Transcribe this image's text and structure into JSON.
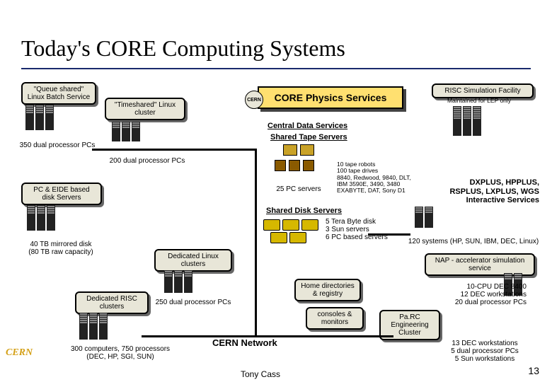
{
  "title": "Today's CORE Computing Systems",
  "headline": {
    "label": "CORE Physics Services",
    "tag": "CERN"
  },
  "left": {
    "queueShared": "\"Queue shared\" Linux Batch Service",
    "queueSharedNote": "350 dual processor PCs",
    "pcEide": "PC & EIDE based disk Servers",
    "mirrored": "40 TB mirrored disk\n(80 TB raw capacity)",
    "dedicatedRisc": "Dedicated RISC clusters",
    "riscNote": "300 computers, 750 processors\n(DEC, HP, SGI, SUN)"
  },
  "mid": {
    "timeshared": "\"Timeshared\" Linux cluster",
    "timesharedNote": "200 dual processor PCs",
    "dedicatedLinux": "Dedicated Linux clusters",
    "dedicatedLinuxNote": "250 dual processor PCs"
  },
  "center": {
    "centralData": "Central Data Services",
    "sharedTape": "Shared Tape Servers",
    "tapeServers": "25 PC servers",
    "tapeDetails": "10 tape robots\n100 tape drives\n8840, Redwood, 9840, DLT,\nIBM 3590E, 3490, 3480\nEXABYTE, DAT, Sony D1",
    "sharedDisk": "Shared Disk Servers",
    "diskDetails": "5 Tera Byte disk\n3 Sun servers\n6 PC based servers",
    "home": "Home directories & registry",
    "consoles": "consoles & monitors",
    "cernNetwork": "CERN Network"
  },
  "right": {
    "riscSim": "RISC Simulation Facility",
    "riscSimNote": "Maintained for LEP only",
    "dxplus": "DXPLUS, HPPLUS,\nRSPLUS, LXPLUS, WGS\nInteractive Services",
    "systems120": "120 systems (HP, SUN, IBM, DEC, Linux)",
    "nap": "NAP - accelerator simulation service",
    "napNote": "10-CPU DEC 8400\n12 DEC workstations\n20 dual processor PCs",
    "parc": "Pa.RC Engineering Cluster",
    "parcNote": "13 DEC workstations\n5 dual processor PCs\n5 Sun workstations"
  },
  "footer": "Tony Cass",
  "page": "13",
  "logo": "CERN"
}
